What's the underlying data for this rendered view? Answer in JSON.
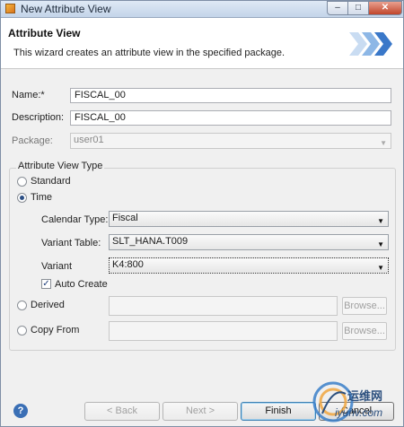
{
  "window": {
    "title": "New Attribute View"
  },
  "header": {
    "title": "Attribute View",
    "description": "This wizard creates an attribute view in the specified package."
  },
  "form": {
    "name_label": "Name:*",
    "name_value": "FISCAL_00",
    "description_label": "Description:",
    "description_value": "FISCAL_00",
    "package_label": "Package:",
    "package_value": "user01"
  },
  "type_group": {
    "title": "Attribute View Type",
    "standard_label": "Standard",
    "time_label": "Time",
    "calendar_type_label": "Calendar Type:",
    "calendar_type_value": "Fiscal",
    "variant_table_label": "Variant Table:",
    "variant_table_value": "SLT_HANA.T009",
    "variant_label": "Variant",
    "variant_value": "K4:800",
    "auto_create_label": "Auto Create",
    "derived_label": "Derived",
    "copy_from_label": "Copy From",
    "browse_label": "Browse...",
    "browse_label_2": "Browse..."
  },
  "buttons": {
    "back": "< Back",
    "next": "Next >",
    "finish": "Finish",
    "cancel": "Cancel"
  },
  "watermark": {
    "text": "运维网",
    "sub": "iyunv.com"
  },
  "icons": {
    "help": "help-icon",
    "app": "app-icon",
    "wizard_banner": "chevron-banner-icon"
  },
  "state": {
    "selected_type": "Time",
    "auto_create_checked": true
  }
}
